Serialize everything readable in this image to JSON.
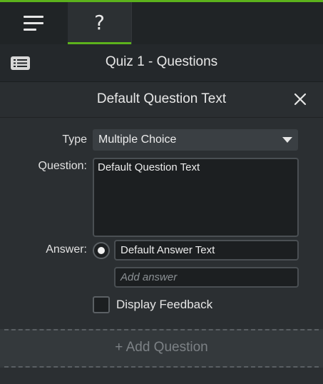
{
  "tabs": {
    "menu_icon": "hamburger-icon",
    "help_label": "?"
  },
  "quiz_header": {
    "icon": "quiz-list-icon",
    "title": "Quiz 1 - Questions"
  },
  "question_bar": {
    "title": "Default Question Text",
    "close_icon": "close-icon"
  },
  "form": {
    "type_label": "Type",
    "type_value": "Multiple Choice",
    "question_label": "Question:",
    "question_value": "Default Question Text",
    "answer_label": "Answer:",
    "answers": [
      {
        "value": "Default Answer Text",
        "selected": true
      }
    ],
    "add_answer_placeholder": "Add answer",
    "display_feedback_label": "Display Feedback",
    "display_feedback_checked": false
  },
  "add_question_label": "+ Add Question",
  "colors": {
    "accent": "#5cb21c",
    "background": "#2b2f32",
    "field_bg": "#1c1f21"
  }
}
